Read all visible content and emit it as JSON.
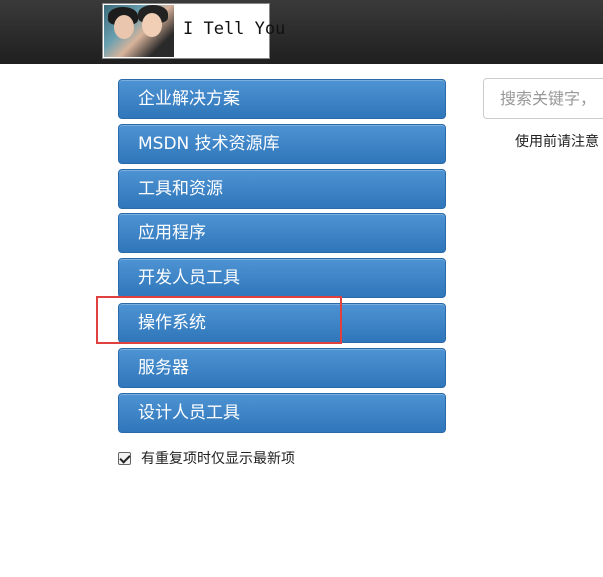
{
  "header": {
    "logo_text": "I Tell You"
  },
  "menu": {
    "items": [
      {
        "label": "企业解决方案"
      },
      {
        "label": "MSDN 技术资源库"
      },
      {
        "label": "工具和资源"
      },
      {
        "label": "应用程序"
      },
      {
        "label": "开发人员工具"
      },
      {
        "label": "操作系统"
      },
      {
        "label": "服务器"
      },
      {
        "label": "设计人员工具"
      }
    ]
  },
  "filter": {
    "checkbox_label": "有重复项时仅显示最新项",
    "checked": true
  },
  "search": {
    "placeholder": "搜索关键字，"
  },
  "notice": {
    "text": "使用前请注意"
  },
  "colors": {
    "topbar": "#2a2a2a",
    "menu_button": "#3a83c8",
    "highlight": "#e0413f"
  }
}
